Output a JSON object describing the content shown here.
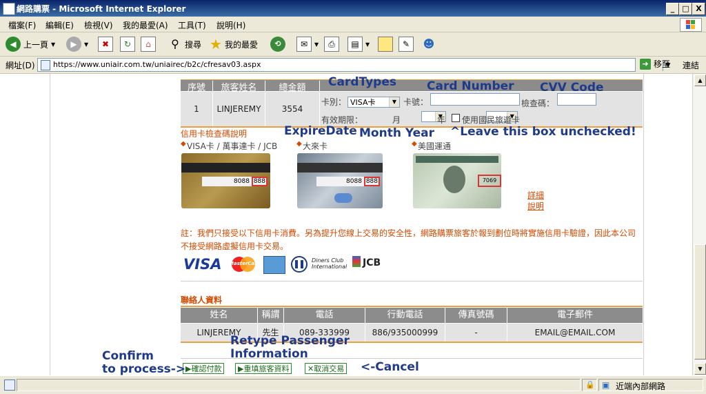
{
  "window": {
    "title": "網路購票 - Microsoft Internet Explorer",
    "minimize": "_",
    "maximize": "□",
    "close": "X"
  },
  "menu": [
    "檔案(F)",
    "編輯(E)",
    "檢視(V)",
    "我的最愛(A)",
    "工具(T)",
    "說明(H)"
  ],
  "toolbar": {
    "back_label": "上一頁",
    "search_label": "搜尋",
    "favorites_label": "我的最愛"
  },
  "address": {
    "label": "網址(D)",
    "url": "https://www.uniair.com.tw/uniairec/b2c/cfresav03.aspx",
    "go_label": "移至",
    "links_label": "連結"
  },
  "passenger_table": {
    "headers": [
      "序號",
      "旅客姓名",
      "總金額"
    ],
    "row": [
      "1",
      "LINJEREMY",
      "3554"
    ]
  },
  "card_form": {
    "card_type_label": "卡別：",
    "card_type_value": "VISA卡",
    "card_no_label": "卡號：",
    "cvv_label": "檢查碼：",
    "expire_label": "有效期限：",
    "month_unit": "月",
    "year_unit": "年",
    "domestic_travel_label": "使用國民旅遊卡"
  },
  "card_help": {
    "title": "信用卡檢查碼說明",
    "visa_label": "VISA卡 / 萬事達卡 / JCB",
    "diners_label": "大來卡",
    "amex_label": "美國運通",
    "detail_link": "詳細說明",
    "visa_code_number": "8088",
    "visa_code": "888",
    "diners_code_number": "8088",
    "diners_code": "888",
    "amex_code": "7069"
  },
  "notice": "註：我們只接受以下信用卡消費。另為提升您線上交易的安全性，網路購票旅客於報到劃位時將實施信用卡驗證，因此本公司不接受網路虛擬信用卡交易。",
  "brand_logos": {
    "visa": "VISA",
    "mastercard": "MasterCard",
    "diners": "Diners Club International",
    "jcb": "JCB"
  },
  "contact": {
    "title": "聯絡人資料",
    "headers": [
      "姓名",
      "稱謂",
      "電話",
      "行動電話",
      "傳真號碼",
      "電子郵件"
    ],
    "row": [
      "LINJEREMY",
      "先生",
      "089-333999",
      "886/935000999",
      "-",
      "EMAIL@EMAIL.COM"
    ]
  },
  "actions": {
    "confirm": "確認付款",
    "retype": "重填旅客資料",
    "cancel": "取消交易"
  },
  "annotations": {
    "card_types": "CardTypes",
    "card_number": "Card Number",
    "cvv_code": "CVV Code",
    "expire_date": "ExpireDate",
    "month_year": "Month Year",
    "leave_unchecked": "^Leave this box unchecked!",
    "confirm_line1": "Confirm",
    "confirm_line2": "to process->",
    "retype_line1": "Retype Passenger",
    "retype_line2": "Information",
    "cancel": "<-Cancel"
  },
  "status": {
    "zone": "近端內部網路"
  },
  "colors": {
    "accent_red": "#d44a00",
    "annotation_blue": "#1f3a8a",
    "header_gray": "#8c8c8c",
    "cell_gray": "#e3e3e3",
    "action_green": "#1a6a1a"
  }
}
